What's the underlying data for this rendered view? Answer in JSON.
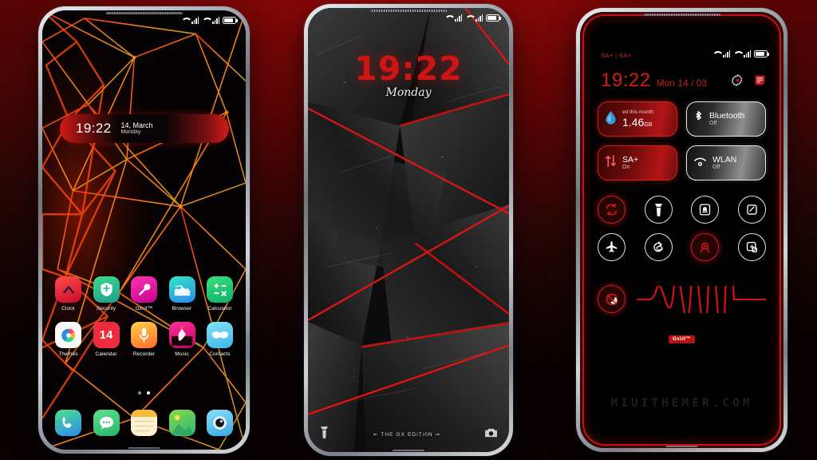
{
  "theme": {
    "name": "GxUI™ THE GX EDiTi0N",
    "accent_red": "#d41b1b",
    "accent_orange": "#ff7a18",
    "background": "#8b0606"
  },
  "phone1": {
    "name": "home-screen",
    "statusbar": {
      "sim1": "signal-icon",
      "sim2": "signal-icon",
      "battery": "battery-icon"
    },
    "clock_widget": {
      "time": "19:22",
      "date": "14, March",
      "day": "Monday"
    },
    "apps_row1": [
      {
        "label": "Clock",
        "icon": "clock-icon"
      },
      {
        "label": "Security",
        "icon": "shield-icon"
      },
      {
        "label": "GxUI™",
        "icon": "wrench-icon"
      },
      {
        "label": "Browser",
        "icon": "globe-icon"
      },
      {
        "label": "Calculator",
        "icon": "calculator-icon"
      }
    ],
    "apps_row2": [
      {
        "label": "Themes",
        "icon": "themes-icon"
      },
      {
        "label": "Calendar",
        "icon": "calendar-icon",
        "day_number": "14"
      },
      {
        "label": "Recorder",
        "icon": "microphone-icon"
      },
      {
        "label": "Music",
        "icon": "music-icon"
      },
      {
        "label": "Contacts",
        "icon": "contacts-icon"
      }
    ],
    "dock": [
      {
        "label": "Phone",
        "icon": "phone-icon"
      },
      {
        "label": "Messages",
        "icon": "message-icon"
      },
      {
        "label": "Notes",
        "icon": "notes-icon"
      },
      {
        "label": "Gallery",
        "icon": "gallery-icon"
      },
      {
        "label": "Camera",
        "icon": "camera-icon"
      }
    ],
    "page_indicator": {
      "total": 2,
      "active": 2
    }
  },
  "phone2": {
    "name": "lock-screen",
    "clock": {
      "time": "19:22",
      "day": "Monday"
    },
    "signature": "⇜ THE GX EDiTi0N ⇝",
    "shortcut_left": "flashlight-icon",
    "shortcut_right": "camera-icon"
  },
  "phone3": {
    "name": "control-center",
    "sim_label": "SA+ | SA+",
    "time": "19:22",
    "date": "Mon 14 / 03",
    "actions": [
      {
        "name": "settings-gear-icon"
      },
      {
        "name": "edit-toggles-icon"
      }
    ],
    "cards": [
      {
        "id": "data-usage",
        "style": "red",
        "icon": "data-drop-icon",
        "top": "ed this month",
        "value": "1.46",
        "unit": "GB"
      },
      {
        "id": "bluetooth",
        "style": "gray",
        "icon": "bluetooth-icon",
        "title": "Bluetooth",
        "sub": "Off"
      },
      {
        "id": "mobile-data",
        "style": "red",
        "icon": "data-arrows-icon",
        "title": "SA+",
        "sub": "On"
      },
      {
        "id": "wlan",
        "style": "gray",
        "icon": "wifi-icon",
        "title": "WLAN",
        "sub": "Off"
      }
    ],
    "toggles_row1": [
      {
        "name": "sync-icon",
        "active": true
      },
      {
        "name": "flashlight-icon",
        "active": false
      },
      {
        "name": "ringer-bell-icon",
        "active": false
      },
      {
        "name": "screenshot-icon",
        "active": false
      }
    ],
    "toggles_row2": [
      {
        "name": "airplane-mode-icon",
        "active": false
      },
      {
        "name": "auto-rotate-icon",
        "active": false
      },
      {
        "name": "location-icon",
        "active": true
      },
      {
        "name": "screen-record-icon",
        "active": false
      }
    ],
    "toggles_row3": [
      {
        "name": "do-not-disturb-icon",
        "active": true
      }
    ],
    "brightness_slider": "waveform-slider",
    "badge": "GxUI™",
    "watermark": "MIUITHEMER.COM"
  }
}
